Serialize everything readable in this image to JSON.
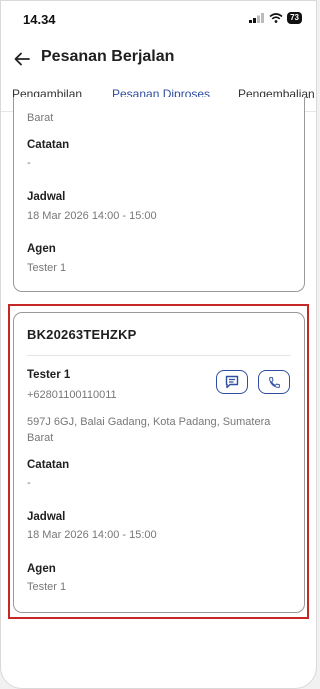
{
  "status": {
    "time": "14.34",
    "battery": "73"
  },
  "header": {
    "title": "Pesanan Berjalan"
  },
  "tabs": [
    {
      "label": "Pengambilan",
      "active": false
    },
    {
      "label": "Pesanan Diproses",
      "active": true
    },
    {
      "label": "Pengembalian",
      "active": false
    }
  ],
  "orders": [
    {
      "address_tail": "Barat",
      "notes_label": "Catatan",
      "notes": "-",
      "schedule_label": "Jadwal",
      "schedule": "18 Mar 2026  14:00 - 15:00",
      "agent_label": "Agen",
      "agent": "Tester 1"
    },
    {
      "id": "BK20263TEHZKP",
      "customer_name": "Tester 1",
      "phone": "+62801100110011",
      "address_line1": "597J 6GJ, Balai Gadang, Kota Padang, Sumatera",
      "address_line2": "Barat",
      "notes_label": "Catatan",
      "notes": "-",
      "schedule_label": "Jadwal",
      "schedule": "18 Mar 2026  14:00 - 15:00",
      "agent_label": "Agen",
      "agent": "Tester 1"
    }
  ],
  "colors": {
    "accent": "#2f4ea0",
    "highlight": "#c62828"
  }
}
